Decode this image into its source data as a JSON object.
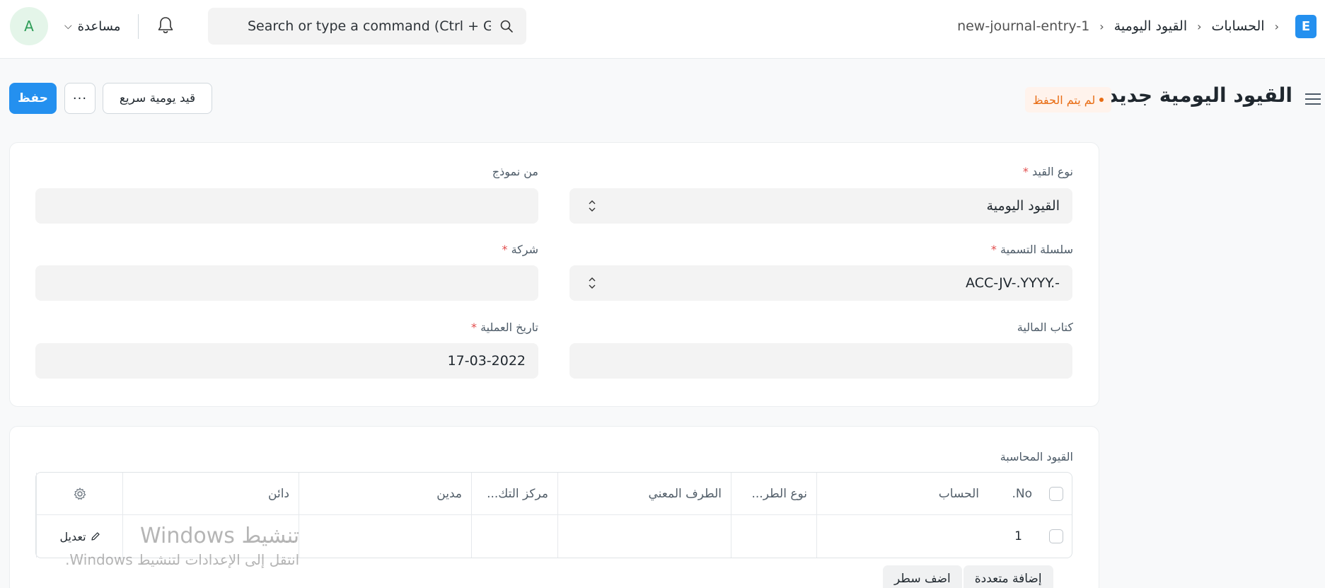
{
  "navbar": {
    "brand_letter": "E",
    "breadcrumbs": [
      "الحسابات",
      "القيود اليومية",
      "new-journal-entry-1"
    ],
    "search_placeholder": "Search or type a command (Ctrl + G)",
    "help_label": "مساعدة",
    "avatar_initial": "A"
  },
  "page": {
    "title": "القيود اليومية جديد",
    "status": "لم يتم الحفظ",
    "quick_entry_label": "قيد يومية سريع",
    "more_label": "···",
    "save_label": "حفظ"
  },
  "form": {
    "entry_type": {
      "label": "نوع القيد",
      "required": "*",
      "value": "القيود اليومية"
    },
    "from_template": {
      "label": "من نموذج",
      "value": ""
    },
    "naming_series": {
      "label": "سلسلة التسمية",
      "required": "*",
      "value": "ACC-JV-.YYYY.-"
    },
    "company": {
      "label": "شركة",
      "required": "*",
      "value": ""
    },
    "finance_book": {
      "label": "كتاب المالية",
      "value": ""
    },
    "posting_date": {
      "label": "تاريخ العملية",
      "required": "*",
      "value": "17-03-2022"
    }
  },
  "accounts": {
    "section_label": "القيود المحاسبة",
    "columns": [
      "No.",
      "الحساب",
      "نوع الطر...",
      "الطرف المعني",
      "مركز التك...",
      "مدين",
      "دائن"
    ],
    "rows": [
      {
        "no": "1",
        "account": "",
        "party_type": "",
        "party": "",
        "cost_center": "",
        "debit": "",
        "credit": ""
      }
    ],
    "edit_label": "تعديل",
    "add_multiple_label": "إضافة متعددة",
    "add_row_label": "اضف سطر"
  },
  "watermark": {
    "title": "تنشيط Windows",
    "subtitle": "انتقل إلى الإعدادات لتنشيط Windows."
  },
  "colors": {
    "primary": "#2490ef",
    "status_orange": "#e86c13",
    "required_red": "#e24c4c"
  }
}
